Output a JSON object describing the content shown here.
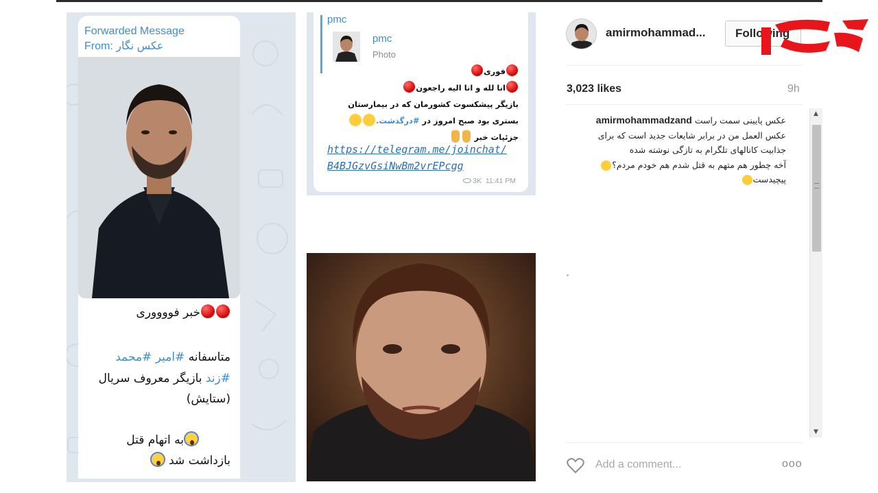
{
  "left_telegram": {
    "forwarded_label": "Forwarded Message",
    "from_label": "From:",
    "from_name": "عکس نگار",
    "headline": "خبر فووووری",
    "line1_prefix": "متاسفانه",
    "hashtag_amir": "#امیر",
    "hashtag_mohammad": "#محمد",
    "hashtag_zand": "#زند",
    "line2_rest": "بازیگر معروف سریال",
    "line3": "(ستایش)",
    "line4": "به اتهام قتل",
    "line5": "بازداشت شد"
  },
  "mid_telegram": {
    "channel": "pmc",
    "reply_name": "pmc",
    "reply_type": "Photo",
    "line1": "فوری",
    "line2": "انا لله و انا الیه راجعون",
    "line3": "بازیگر پیشکسوت کشورمان که در بیمارستان",
    "line4_prefix": "بستری بود صبح امروز در",
    "line4_hashtag": "#درگذشت.",
    "line5": "جزئیات خبر",
    "link1": "https://telegram.me/joinchat/",
    "link2": "B4BJGzvGsiNwBm2vrEPcgg",
    "views": "3K",
    "time": "11:41 PM"
  },
  "instagram": {
    "username": "amirmohammad...",
    "follow_label": "Following",
    "likes": "3,023 likes",
    "time_ago": "9h",
    "caption_user": "amirmohammadzand",
    "caption_line1": "عکس پایینی سمت راست",
    "caption_line2": "عکس العمل من در برابر شایعات جدید است که برای",
    "caption_line3": "جذابیت کانالهای تلگرام به تازگی نوشته شده",
    "caption_line4": "آخه چطور هم متهم به قتل شدم هم خودم مردم؟",
    "caption_line5": "پیچیدست",
    "add_comment_placeholder": "Add a comment...",
    "more_label": "ooo"
  },
  "colors": {
    "telegram_blue": "#3b8fd1",
    "link_blue": "#2a6fb6",
    "logo_red": "#e8151b",
    "panel_bg": "#dfe6ee"
  },
  "icons": [
    "red-circle-icon",
    "scream-emoji-icon",
    "sad-emoji-icon",
    "pointing-down-icon",
    "eye-icon",
    "heart-icon",
    "more-dots-icon",
    "scroll-up-icon",
    "scroll-down-icon"
  ]
}
